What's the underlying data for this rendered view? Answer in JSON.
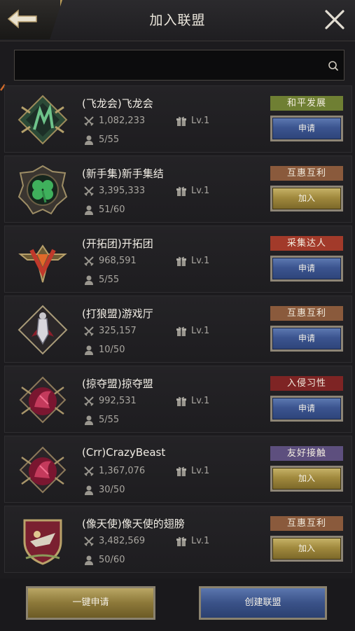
{
  "header": {
    "title": "加入联盟",
    "back_icon": "back-arrow-icon",
    "close_icon": "close-icon"
  },
  "search": {
    "value": "",
    "placeholder": "",
    "icon": "search-icon"
  },
  "colors": {
    "tag_green": "#6f7f33",
    "tag_brown": "#8a5a3c",
    "tag_red": "#a23a2a",
    "tag_darkred": "#7e2424",
    "tag_purple": "#5d4f7e",
    "button_blue": "#3c5590",
    "button_gold": "#a18a3e"
  },
  "alliances": [
    {
      "name": "(飞龙会)飞龙会",
      "power": "1,082,233",
      "members": "5/55",
      "level": "Lv.1",
      "tag": "和平发展",
      "tag_color": "#6f7f33",
      "action": "申请",
      "action_style": "blue",
      "emblem": "dragon-emblem-icon"
    },
    {
      "name": "(新手集)新手集结",
      "power": "3,395,333",
      "members": "51/60",
      "level": "Lv.1",
      "tag": "互惠互利",
      "tag_color": "#8a5a3c",
      "action": "加入",
      "action_style": "gold",
      "emblem": "clover-emblem-icon"
    },
    {
      "name": "(开拓团)开拓团",
      "power": "968,591",
      "members": "5/55",
      "level": "Lv.1",
      "tag": "采集达人",
      "tag_color": "#a23a2a",
      "action": "申请",
      "action_style": "blue",
      "emblem": "winged-emblem-icon"
    },
    {
      "name": "(打狼盟)游戏厅",
      "power": "325,157",
      "members": "10/50",
      "level": "Lv.1",
      "tag": "互惠互利",
      "tag_color": "#8a5a3c",
      "action": "申请",
      "action_style": "blue",
      "emblem": "knight-emblem-icon"
    },
    {
      "name": "(掠夺盟)掠夺盟",
      "power": "992,531",
      "members": "5/55",
      "level": "Lv.1",
      "tag": "入侵习性",
      "tag_color": "#7e2424",
      "action": "申请",
      "action_style": "blue",
      "emblem": "beast-emblem-icon"
    },
    {
      "name": "(Crr)CrazyBeast",
      "power": "1,367,076",
      "members": "30/50",
      "level": "Lv.1",
      "tag": "友好接触",
      "tag_color": "#5d4f7e",
      "action": "加入",
      "action_style": "gold",
      "emblem": "beast-emblem-icon"
    },
    {
      "name": "(像天使)像天使的翅膀",
      "power": "3,482,569",
      "members": "50/60",
      "level": "Lv.1",
      "tag": "互惠互利",
      "tag_color": "#8a5a3c",
      "action": "加入",
      "action_style": "gold",
      "emblem": "shield-emblem-icon"
    }
  ],
  "footer": {
    "quick_apply": "一键申请",
    "create_alliance": "创建联盟"
  }
}
